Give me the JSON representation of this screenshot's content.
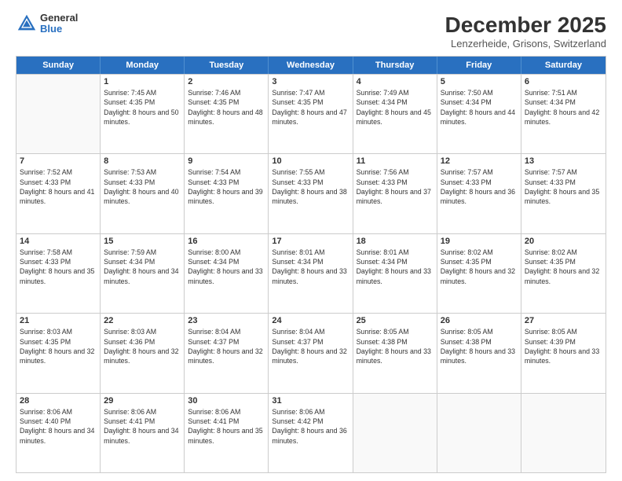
{
  "header": {
    "logo_general": "General",
    "logo_blue": "Blue",
    "month": "December 2025",
    "location": "Lenzerheide, Grisons, Switzerland"
  },
  "weekdays": [
    "Sunday",
    "Monday",
    "Tuesday",
    "Wednesday",
    "Thursday",
    "Friday",
    "Saturday"
  ],
  "rows": [
    [
      {
        "day": "",
        "sunrise": "",
        "sunset": "",
        "daylight": ""
      },
      {
        "day": "1",
        "sunrise": "Sunrise: 7:45 AM",
        "sunset": "Sunset: 4:35 PM",
        "daylight": "Daylight: 8 hours and 50 minutes."
      },
      {
        "day": "2",
        "sunrise": "Sunrise: 7:46 AM",
        "sunset": "Sunset: 4:35 PM",
        "daylight": "Daylight: 8 hours and 48 minutes."
      },
      {
        "day": "3",
        "sunrise": "Sunrise: 7:47 AM",
        "sunset": "Sunset: 4:35 PM",
        "daylight": "Daylight: 8 hours and 47 minutes."
      },
      {
        "day": "4",
        "sunrise": "Sunrise: 7:49 AM",
        "sunset": "Sunset: 4:34 PM",
        "daylight": "Daylight: 8 hours and 45 minutes."
      },
      {
        "day": "5",
        "sunrise": "Sunrise: 7:50 AM",
        "sunset": "Sunset: 4:34 PM",
        "daylight": "Daylight: 8 hours and 44 minutes."
      },
      {
        "day": "6",
        "sunrise": "Sunrise: 7:51 AM",
        "sunset": "Sunset: 4:34 PM",
        "daylight": "Daylight: 8 hours and 42 minutes."
      }
    ],
    [
      {
        "day": "7",
        "sunrise": "Sunrise: 7:52 AM",
        "sunset": "Sunset: 4:33 PM",
        "daylight": "Daylight: 8 hours and 41 minutes."
      },
      {
        "day": "8",
        "sunrise": "Sunrise: 7:53 AM",
        "sunset": "Sunset: 4:33 PM",
        "daylight": "Daylight: 8 hours and 40 minutes."
      },
      {
        "day": "9",
        "sunrise": "Sunrise: 7:54 AM",
        "sunset": "Sunset: 4:33 PM",
        "daylight": "Daylight: 8 hours and 39 minutes."
      },
      {
        "day": "10",
        "sunrise": "Sunrise: 7:55 AM",
        "sunset": "Sunset: 4:33 PM",
        "daylight": "Daylight: 8 hours and 38 minutes."
      },
      {
        "day": "11",
        "sunrise": "Sunrise: 7:56 AM",
        "sunset": "Sunset: 4:33 PM",
        "daylight": "Daylight: 8 hours and 37 minutes."
      },
      {
        "day": "12",
        "sunrise": "Sunrise: 7:57 AM",
        "sunset": "Sunset: 4:33 PM",
        "daylight": "Daylight: 8 hours and 36 minutes."
      },
      {
        "day": "13",
        "sunrise": "Sunrise: 7:57 AM",
        "sunset": "Sunset: 4:33 PM",
        "daylight": "Daylight: 8 hours and 35 minutes."
      }
    ],
    [
      {
        "day": "14",
        "sunrise": "Sunrise: 7:58 AM",
        "sunset": "Sunset: 4:33 PM",
        "daylight": "Daylight: 8 hours and 35 minutes."
      },
      {
        "day": "15",
        "sunrise": "Sunrise: 7:59 AM",
        "sunset": "Sunset: 4:34 PM",
        "daylight": "Daylight: 8 hours and 34 minutes."
      },
      {
        "day": "16",
        "sunrise": "Sunrise: 8:00 AM",
        "sunset": "Sunset: 4:34 PM",
        "daylight": "Daylight: 8 hours and 33 minutes."
      },
      {
        "day": "17",
        "sunrise": "Sunrise: 8:01 AM",
        "sunset": "Sunset: 4:34 PM",
        "daylight": "Daylight: 8 hours and 33 minutes."
      },
      {
        "day": "18",
        "sunrise": "Sunrise: 8:01 AM",
        "sunset": "Sunset: 4:34 PM",
        "daylight": "Daylight: 8 hours and 33 minutes."
      },
      {
        "day": "19",
        "sunrise": "Sunrise: 8:02 AM",
        "sunset": "Sunset: 4:35 PM",
        "daylight": "Daylight: 8 hours and 32 minutes."
      },
      {
        "day": "20",
        "sunrise": "Sunrise: 8:02 AM",
        "sunset": "Sunset: 4:35 PM",
        "daylight": "Daylight: 8 hours and 32 minutes."
      }
    ],
    [
      {
        "day": "21",
        "sunrise": "Sunrise: 8:03 AM",
        "sunset": "Sunset: 4:35 PM",
        "daylight": "Daylight: 8 hours and 32 minutes."
      },
      {
        "day": "22",
        "sunrise": "Sunrise: 8:03 AM",
        "sunset": "Sunset: 4:36 PM",
        "daylight": "Daylight: 8 hours and 32 minutes."
      },
      {
        "day": "23",
        "sunrise": "Sunrise: 8:04 AM",
        "sunset": "Sunset: 4:37 PM",
        "daylight": "Daylight: 8 hours and 32 minutes."
      },
      {
        "day": "24",
        "sunrise": "Sunrise: 8:04 AM",
        "sunset": "Sunset: 4:37 PM",
        "daylight": "Daylight: 8 hours and 32 minutes."
      },
      {
        "day": "25",
        "sunrise": "Sunrise: 8:05 AM",
        "sunset": "Sunset: 4:38 PM",
        "daylight": "Daylight: 8 hours and 33 minutes."
      },
      {
        "day": "26",
        "sunrise": "Sunrise: 8:05 AM",
        "sunset": "Sunset: 4:38 PM",
        "daylight": "Daylight: 8 hours and 33 minutes."
      },
      {
        "day": "27",
        "sunrise": "Sunrise: 8:05 AM",
        "sunset": "Sunset: 4:39 PM",
        "daylight": "Daylight: 8 hours and 33 minutes."
      }
    ],
    [
      {
        "day": "28",
        "sunrise": "Sunrise: 8:06 AM",
        "sunset": "Sunset: 4:40 PM",
        "daylight": "Daylight: 8 hours and 34 minutes."
      },
      {
        "day": "29",
        "sunrise": "Sunrise: 8:06 AM",
        "sunset": "Sunset: 4:41 PM",
        "daylight": "Daylight: 8 hours and 34 minutes."
      },
      {
        "day": "30",
        "sunrise": "Sunrise: 8:06 AM",
        "sunset": "Sunset: 4:41 PM",
        "daylight": "Daylight: 8 hours and 35 minutes."
      },
      {
        "day": "31",
        "sunrise": "Sunrise: 8:06 AM",
        "sunset": "Sunset: 4:42 PM",
        "daylight": "Daylight: 8 hours and 36 minutes."
      },
      {
        "day": "",
        "sunrise": "",
        "sunset": "",
        "daylight": ""
      },
      {
        "day": "",
        "sunrise": "",
        "sunset": "",
        "daylight": ""
      },
      {
        "day": "",
        "sunrise": "",
        "sunset": "",
        "daylight": ""
      }
    ]
  ]
}
